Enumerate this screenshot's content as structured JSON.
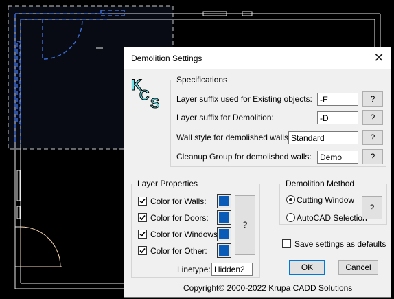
{
  "dialog": {
    "title": "Demolition Settings",
    "close_glyph": "✕",
    "logo_text": "KCS"
  },
  "specifications": {
    "group_label": "Specifications",
    "rows": [
      {
        "label": "Layer suffix used for Existing objects:",
        "value": "-E",
        "help": "?"
      },
      {
        "label": "Layer suffix for Demolition:",
        "value": "-D",
        "help": "?"
      },
      {
        "label": "Wall style for demolished walls:",
        "value": "Standard",
        "help": "?"
      },
      {
        "label": "Cleanup Group for demolished walls:",
        "value": "Demo",
        "help": "?"
      }
    ]
  },
  "layer_properties": {
    "group_label": "Layer Properties",
    "items": [
      {
        "label": "Color for Walls:",
        "checked": true
      },
      {
        "label": "Color for Doors:",
        "checked": true
      },
      {
        "label": "Color for Windows:",
        "checked": true
      },
      {
        "label": "Color for Other:",
        "checked": true
      }
    ],
    "swatch_color": "#0a5bb8",
    "help": "?",
    "linetype_label": "Linetype:",
    "linetype_value": "Hidden2"
  },
  "demolition_method": {
    "group_label": "Demolition Method",
    "options": [
      {
        "label": "Cutting Window",
        "selected": true
      },
      {
        "label": "AutoCAD Selection",
        "selected": false
      }
    ],
    "help": "?"
  },
  "save_defaults": {
    "label": "Save settings as defaults",
    "checked": false
  },
  "buttons": {
    "ok": "OK",
    "cancel": "Cancel"
  },
  "copyright": "Copyright© 2000-2022  Krupa CADD Solutions"
}
